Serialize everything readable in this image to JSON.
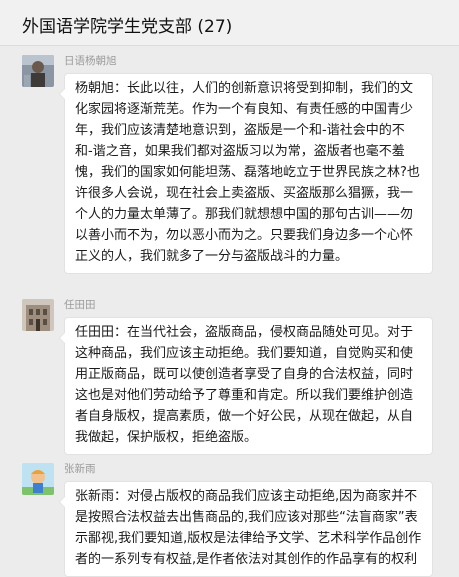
{
  "header": {
    "title": "外国语学院学生党支部 (27)"
  },
  "messages": [
    {
      "sender": "日语杨朝旭",
      "avatar": "person-photo-avatar",
      "text": "杨朝旭：长此以往，人们的创新意识将受到抑制，我们的文化家园将逐渐荒芜。作为一个有良知、有责任感的中国青少年，我们应该清楚地意识到，盗版是一个和-谐社会中的不和-谐之音，如果我们都对盗版习以为常，盗版者也毫不羞愧，我们的国家如何能坦荡、磊落地屹立于世界民族之林?也许很多人会说，现在社会上卖盗版、买盗版那么猖獗，我一个人的力量太单薄了。那我们就想想中国的那句古训——勿以善小而不为，勿以恶小而为之。只要我们身边多一个心怀正义的人，我们就多了一分与盗版战斗的力量。"
    },
    {
      "sender": "任田田",
      "avatar": "building-photo-avatar",
      "text": "任田田：在当代社会，盗版商品，侵权商品随处可见。对于这种商品，我们应该主动拒绝。我们要知道，自觉购买和使用正版商品，既可以使创造者享受了自身的合法权益，同时这也是对他们劳动给予了尊重和肯定。所以我们要维护创造者自身版权，提高素质，做一个好公民，从现在做起，从自我做起，保护版权，拒绝盗版。"
    },
    {
      "sender": "张新雨",
      "avatar": "cartoon-avatar",
      "text": "张新雨：对侵占版权的商品我们应该主动拒绝,因为商家并不是按照合法权益去出售商品的,我们应该对那些“法盲商家”表示鄙视,我们要知道,版权是法律给予文学、艺术科学作品创作者的一系列专有权益,是作者依法对其创作的作品享有的权利"
    }
  ]
}
